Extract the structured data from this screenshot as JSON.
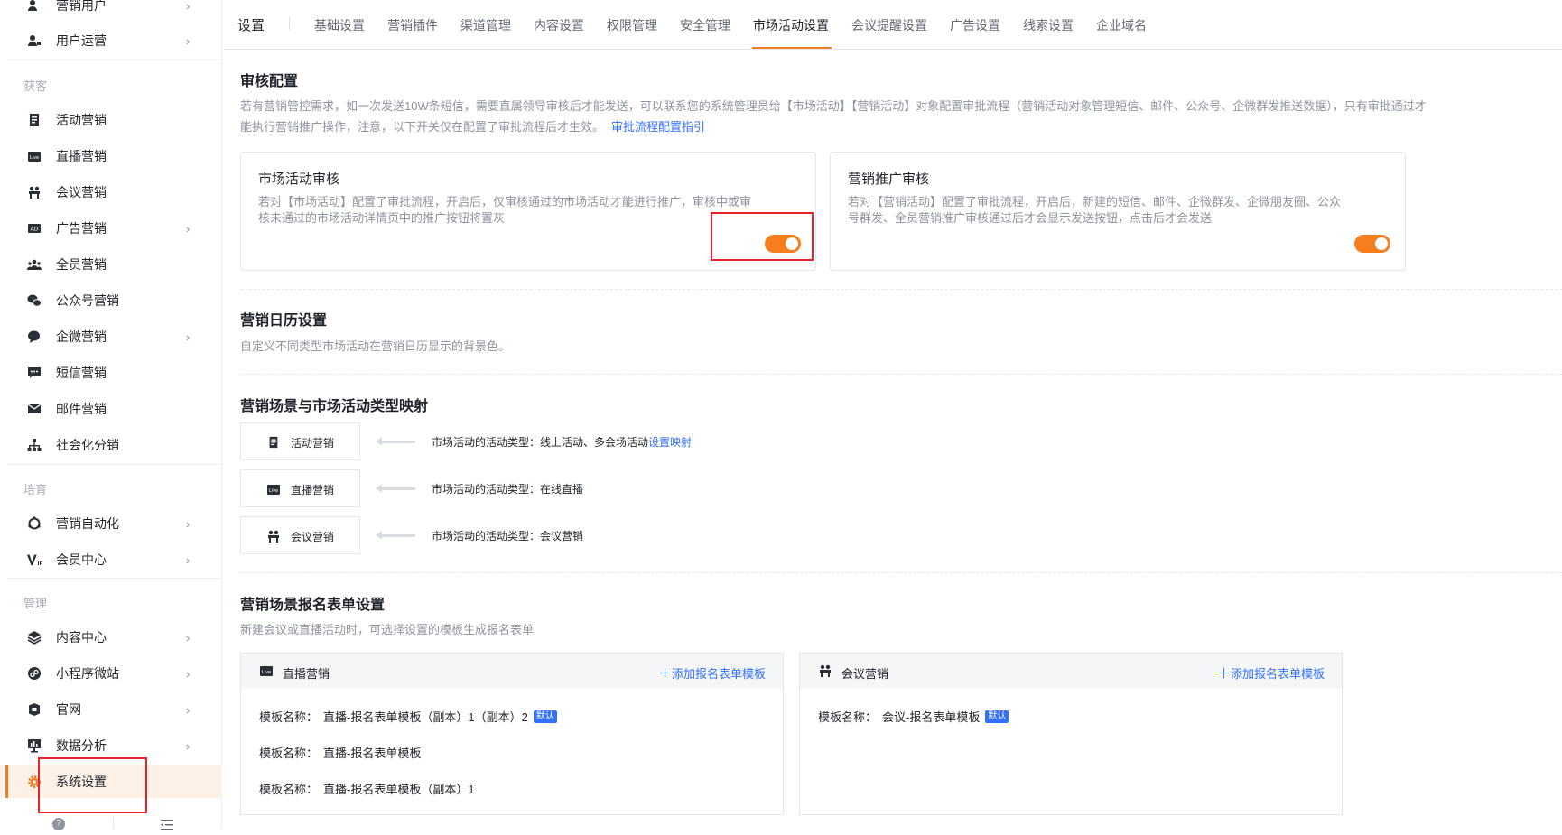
{
  "sidebar": {
    "items_top": [
      {
        "label": "营销用户",
        "icon": "users-icon",
        "chevron": true
      },
      {
        "label": "用户运营",
        "icon": "user-ops-icon",
        "chevron": true
      }
    ],
    "group_acquire": "获客",
    "items_acquire": [
      {
        "label": "活动营销",
        "icon": "document-icon",
        "chevron": false
      },
      {
        "label": "直播营销",
        "icon": "live-tv-icon",
        "chevron": false
      },
      {
        "label": "会议营销",
        "icon": "meeting-icon",
        "chevron": false
      },
      {
        "label": "广告营销",
        "icon": "ad-icon",
        "chevron": true
      },
      {
        "label": "全员营销",
        "icon": "team-icon",
        "chevron": false
      },
      {
        "label": "公众号营销",
        "icon": "wechat-icon",
        "chevron": false
      },
      {
        "label": "企微营销",
        "icon": "wecom-icon",
        "chevron": true
      },
      {
        "label": "短信营销",
        "icon": "sms-icon",
        "chevron": false
      },
      {
        "label": "邮件营销",
        "icon": "mail-icon",
        "chevron": false
      },
      {
        "label": "社会化分销",
        "icon": "distribution-icon",
        "chevron": false
      }
    ],
    "group_nurture": "培育",
    "items_nurture": [
      {
        "label": "营销自动化",
        "icon": "automation-icon",
        "chevron": true
      },
      {
        "label": "会员中心",
        "icon": "vip-icon",
        "chevron": true
      }
    ],
    "group_manage": "管理",
    "items_manage": [
      {
        "label": "内容中心",
        "icon": "layers-icon",
        "chevron": true
      },
      {
        "label": "小程序微站",
        "icon": "miniapp-icon",
        "chevron": true
      },
      {
        "label": "官网",
        "icon": "website-icon",
        "chevron": true
      },
      {
        "label": "数据分析",
        "icon": "analytics-icon",
        "chevron": true
      },
      {
        "label": "系统设置",
        "icon": "gear-icon",
        "chevron": false,
        "active": true
      }
    ]
  },
  "topbar": {
    "title": "设置",
    "tabs": [
      "基础设置",
      "营销插件",
      "渠道管理",
      "内容设置",
      "权限管理",
      "安全管理",
      "市场活动设置",
      "会议提醒设置",
      "广告设置",
      "线索设置",
      "企业域名"
    ],
    "active_tab": "市场活动设置"
  },
  "review": {
    "title": "审核配置",
    "desc_line1": "若有营销管控需求，如一次发送10W条短信，需要直属领导审核后才能发送，可以联系您的系统管理员给【市场活动】【营销活动】对象配置审批流程（营销活动对象管理短信、邮件、公众号、企微群发推送数据），只有审批通过才",
    "desc_line2": "能执行营销推广操作，注意，以下开关仅在配置了审批流程后才生效。",
    "guide_link": "审批流程配置指引",
    "cards": [
      {
        "title": "市场活动审核",
        "desc_line1": "若对【市场活动】配置了审批流程，开启后，仅审核通过的市场活动才能进行推广，审核中或审",
        "desc_line2": "核未通过的市场活动详情页中的推广按钮将置灰",
        "enabled": true
      },
      {
        "title": "营销推广审核",
        "desc_line1": "若对【营销活动】配置了审批流程，开启后，新建的短信、邮件、企微群发、企微朋友圈、公众",
        "desc_line2": "号群发、全员营销推广审核通过后才会显示发送按钮，点击后才会发送",
        "enabled": true
      }
    ]
  },
  "calendar": {
    "title": "营销日历设置",
    "desc": "自定义不同类型市场活动在营销日历显示的背景色。"
  },
  "mapping": {
    "title": "营销场景与市场活动类型映射",
    "rows": [
      {
        "scene": "活动营销",
        "icon": "document-icon",
        "text": "市场活动的活动类型：线上活动、多会场活动",
        "link": "设置映射"
      },
      {
        "scene": "直播营销",
        "icon": "live-tv-icon",
        "text": "市场活动的活动类型：在线直播",
        "link": ""
      },
      {
        "scene": "会议营销",
        "icon": "meeting-icon",
        "text": "市场活动的活动类型：会议营销",
        "link": ""
      }
    ]
  },
  "forms": {
    "title": "营销场景报名表单设置",
    "desc": "新建会议或直播活动时，可选择设置的模板生成报名表单",
    "panels": [
      {
        "title": "直播营销",
        "icon": "live-tv-icon",
        "add_label": "添加报名表单模板",
        "templates": [
          {
            "key": "模板名称：",
            "name": "直播-报名表单模板（副本）1（副本）2",
            "badge": "默认"
          },
          {
            "key": "模板名称：",
            "name": "直播-报名表单模板",
            "badge": ""
          },
          {
            "key": "模板名称：",
            "name": "直播-报名表单模板（副本）1",
            "badge": ""
          }
        ]
      },
      {
        "title": "会议营销",
        "icon": "meeting-icon",
        "add_label": "添加报名表单模板",
        "templates": [
          {
            "key": "模板名称：",
            "name": "会议-报名表单模板",
            "badge": "默认"
          }
        ]
      }
    ]
  },
  "colors": {
    "accent": "#f07c24",
    "toggle_on": "#f77e1e",
    "link": "#3370ff",
    "highlight": "#e8242a"
  }
}
